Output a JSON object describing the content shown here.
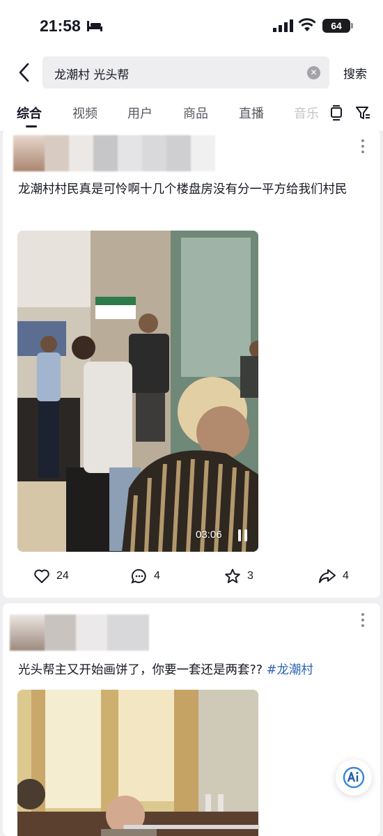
{
  "status_bar": {
    "time": "21:58",
    "battery": "64"
  },
  "search": {
    "query": "龙潮村 光头帮",
    "button_label": "搜索"
  },
  "tabs": [
    {
      "label": "综合",
      "active": true
    },
    {
      "label": "视频"
    },
    {
      "label": "用户"
    },
    {
      "label": "商品"
    },
    {
      "label": "直播"
    },
    {
      "label": "音乐"
    }
  ],
  "posts": [
    {
      "text": "龙潮村村民真是可怜啊十几个楼盘房没有分一平方给我们村民",
      "video_duration": "03:06",
      "likes": "24",
      "comments": "4",
      "favorites": "3",
      "shares": "4"
    },
    {
      "text": "光头帮主又开始画饼了，你要一套还是两套??",
      "hashtag": "#龙潮村"
    }
  ],
  "colors": {
    "accent_link": "#2c64b5",
    "text": "#161823",
    "background": "#efeff1"
  }
}
